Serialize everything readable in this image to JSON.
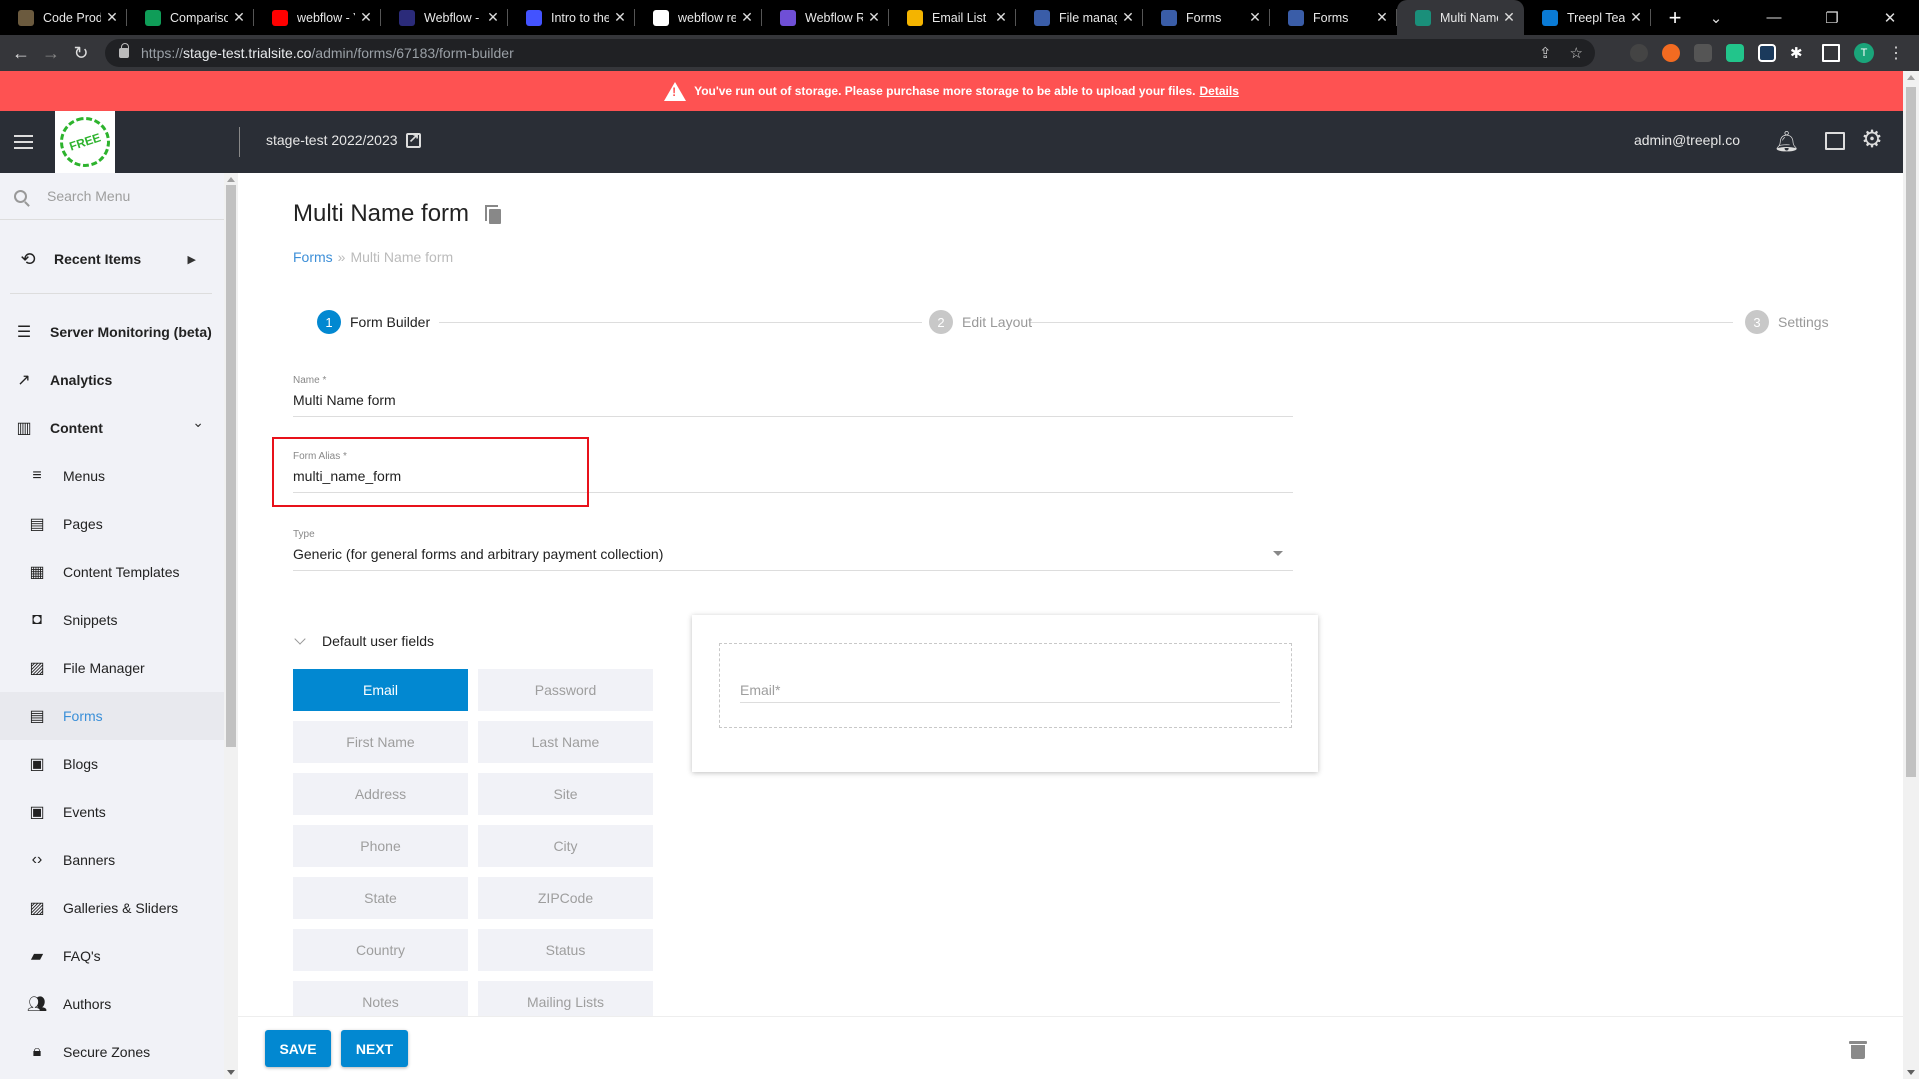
{
  "browser": {
    "tabs": [
      {
        "title": "Code Produ",
        "favicon": "app-icon",
        "color": "#6b5a3e"
      },
      {
        "title": "Comparison",
        "favicon": "sheets-icon",
        "color": "#0f9d58"
      },
      {
        "title": "webflow - Y",
        "favicon": "youtube-icon",
        "color": "#ff0000"
      },
      {
        "title": "Webflow - T",
        "favicon": "webflow-w-icon",
        "color": "#2b2b7a"
      },
      {
        "title": "Intro to the",
        "favicon": "webflow-w-icon",
        "color": "#4353ff"
      },
      {
        "title": "webflow rev",
        "favicon": "google-icon",
        "color": "#ffffff"
      },
      {
        "title": "Webflow Re",
        "favicon": "d-icon",
        "color": "#6f4fd6"
      },
      {
        "title": "Email List Su",
        "favicon": "gear-icon",
        "color": "#f4b400"
      },
      {
        "title": "File manage",
        "favicon": "treepl-icon",
        "color": "#3a5da8"
      },
      {
        "title": "Forms",
        "favicon": "treepl-icon",
        "color": "#3a5da8"
      },
      {
        "title": "Forms",
        "favicon": "treepl-icon",
        "color": "#3a5da8"
      },
      {
        "title": "Multi Name",
        "favicon": "monitor-icon",
        "color": "#1a8f7a",
        "active": true
      },
      {
        "title": "Treepl Team",
        "favicon": "azure-icon",
        "color": "#0a7bd6"
      }
    ],
    "url_scheme": "https://",
    "url_host": "stage-test.trialsite.co",
    "url_path": "/admin/forms/67183/form-builder",
    "profile_initial": "T"
  },
  "notice": {
    "message": "You've run out of storage. Please purchase more storage to be able to upload your files.",
    "link": "Details",
    "color": "#fe5252"
  },
  "header": {
    "logo_text": "FREE",
    "site_name": "stage-test 2022/2023",
    "user_email": "admin@treepl.co"
  },
  "sidebar": {
    "search_placeholder": "Search Menu",
    "recent_items": "Recent Items",
    "top_items": [
      {
        "label": "Server Monitoring (beta)",
        "icon": "server-icon"
      },
      {
        "label": "Analytics",
        "icon": "trending-up-icon"
      },
      {
        "label": "Content",
        "icon": "columns-icon",
        "expanded": true
      }
    ],
    "content_items": [
      {
        "label": "Menus",
        "icon": "menu-lines-icon"
      },
      {
        "label": "Pages",
        "icon": "page-icon"
      },
      {
        "label": "Content Templates",
        "icon": "template-icon"
      },
      {
        "label": "Snippets",
        "icon": "snippet-icon"
      },
      {
        "label": "File Manager",
        "icon": "photo-library-icon"
      },
      {
        "label": "Forms",
        "icon": "form-icon",
        "active": true
      },
      {
        "label": "Blogs",
        "icon": "calendar-icon"
      },
      {
        "label": "Events",
        "icon": "event-icon"
      },
      {
        "label": "Banners",
        "icon": "code-brackets-icon"
      },
      {
        "label": "Galleries & Sliders",
        "icon": "gallery-icon"
      },
      {
        "label": "FAQ's",
        "icon": "forum-icon"
      },
      {
        "label": "Authors",
        "icon": "people-icon"
      },
      {
        "label": "Secure Zones",
        "icon": "lock-icon"
      }
    ]
  },
  "main": {
    "title": "Multi Name form",
    "breadcrumb": {
      "parent": "Forms",
      "separator": "»",
      "current": "Multi Name form"
    },
    "steps": [
      {
        "num": "1",
        "label": "Form Builder",
        "state": "active"
      },
      {
        "num": "2",
        "label": "Edit Layout",
        "state": "pending"
      },
      {
        "num": "3",
        "label": "Settings",
        "state": "pending"
      }
    ],
    "name_field": {
      "label": "Name *",
      "value": "Multi Name form"
    },
    "alias_field": {
      "label": "Form Alias *",
      "value": "multi_name_form"
    },
    "type_field": {
      "label": "Type",
      "value": "Generic (for general forms and arbitrary payment collection)"
    },
    "default_fields_heading": "Default user fields",
    "default_fields": [
      {
        "label": "Email",
        "selected": true
      },
      {
        "label": "Password",
        "selected": false
      },
      {
        "label": "First Name",
        "selected": false
      },
      {
        "label": "Last Name",
        "selected": false
      },
      {
        "label": "Address",
        "selected": false
      },
      {
        "label": "Site",
        "selected": false
      },
      {
        "label": "Phone",
        "selected": false
      },
      {
        "label": "City",
        "selected": false
      },
      {
        "label": "State",
        "selected": false
      },
      {
        "label": "ZIPCode",
        "selected": false
      },
      {
        "label": "Country",
        "selected": false
      },
      {
        "label": "Status",
        "selected": false
      },
      {
        "label": "Notes",
        "selected": false
      },
      {
        "label": "Mailing Lists",
        "selected": false
      }
    ],
    "preview_field_label": "Email*",
    "save_label": "SAVE",
    "next_label": "NEXT",
    "accent_color": "#0288d1"
  }
}
